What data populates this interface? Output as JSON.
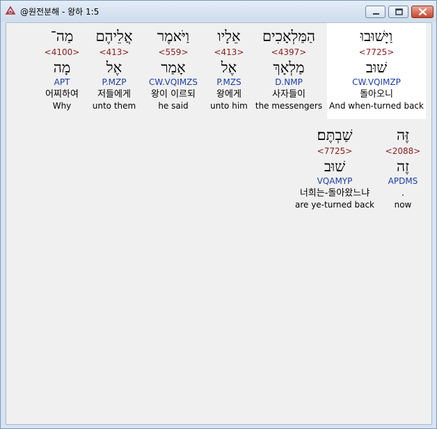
{
  "window": {
    "title": "@원전분해 - 왕하 1:5"
  },
  "words": [
    {
      "hebrew": "מַה־",
      "strongs": "<4100>",
      "lemma": "מָה",
      "morph": "APT",
      "korean": "어찌하여",
      "english": "Why"
    },
    {
      "hebrew": "אֲלֵיהֶם",
      "strongs": "<413>",
      "lemma": "אֶל",
      "morph": "P.MZP",
      "korean": "저들에게",
      "english": "unto them"
    },
    {
      "hebrew": "וַיֹּאמֶר",
      "strongs": "<559>",
      "lemma": "אָמַר",
      "morph": "CW.VQIMZS",
      "korean": "왕이 이르되",
      "english": "he said"
    },
    {
      "hebrew": "אֵלָיו",
      "strongs": "<413>",
      "lemma": "אֶל",
      "morph": "P.MZS",
      "korean": "왕에게",
      "english": "unto him"
    },
    {
      "hebrew": "הַמַּלְאָכִים",
      "strongs": "<4397>",
      "lemma": "מַלְאָךְ",
      "morph": "D.NMP",
      "korean": "사자들이",
      "english": "the messengers"
    },
    {
      "hebrew": "וַיָּשׁוּבוּ",
      "strongs": "<7725>",
      "lemma": "שׁוּב",
      "morph": "CW.VQIMZP",
      "korean": "돌아오니",
      "english": "And when-turned back"
    },
    {
      "hebrew": "שַׁבְתֶּם׃",
      "strongs": "<7725>",
      "lemma": "שׁוּב",
      "morph": "VQAMYP",
      "korean": "너희는-돌아왔느냐",
      "english": "are ye-turned back"
    },
    {
      "hebrew": "זֶּה",
      "strongs": "<2088>",
      "lemma": "זֶה",
      "morph": "APDMS",
      "korean": ".",
      "english": "now"
    }
  ]
}
